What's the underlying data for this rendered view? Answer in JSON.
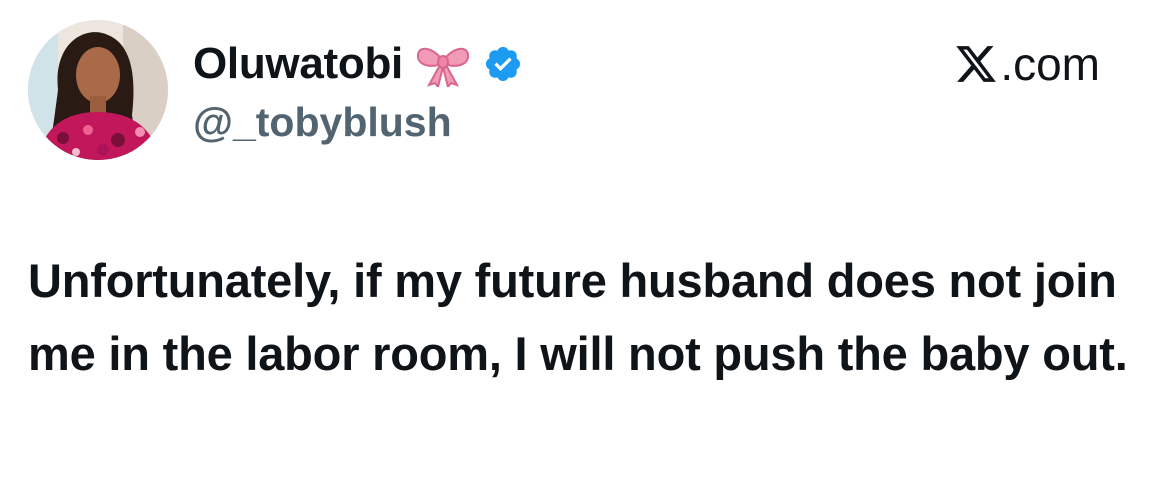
{
  "tweet": {
    "author": {
      "display_name": "Oluwatobi",
      "handle": "@_tobyblush",
      "name_emoji": "ribbon-bow",
      "verified": true,
      "verified_color": "#1d9bf0"
    },
    "platform": {
      "label": ".com",
      "logo_icon": "x-logo-icon"
    },
    "text": "Unfortunately, if my future husband does not join me in the labor room, I will not push the baby out."
  },
  "colors": {
    "text_primary": "#0f1419",
    "text_secondary": "#536471",
    "background": "#ffffff",
    "bow_pink": "#f29bb6"
  }
}
